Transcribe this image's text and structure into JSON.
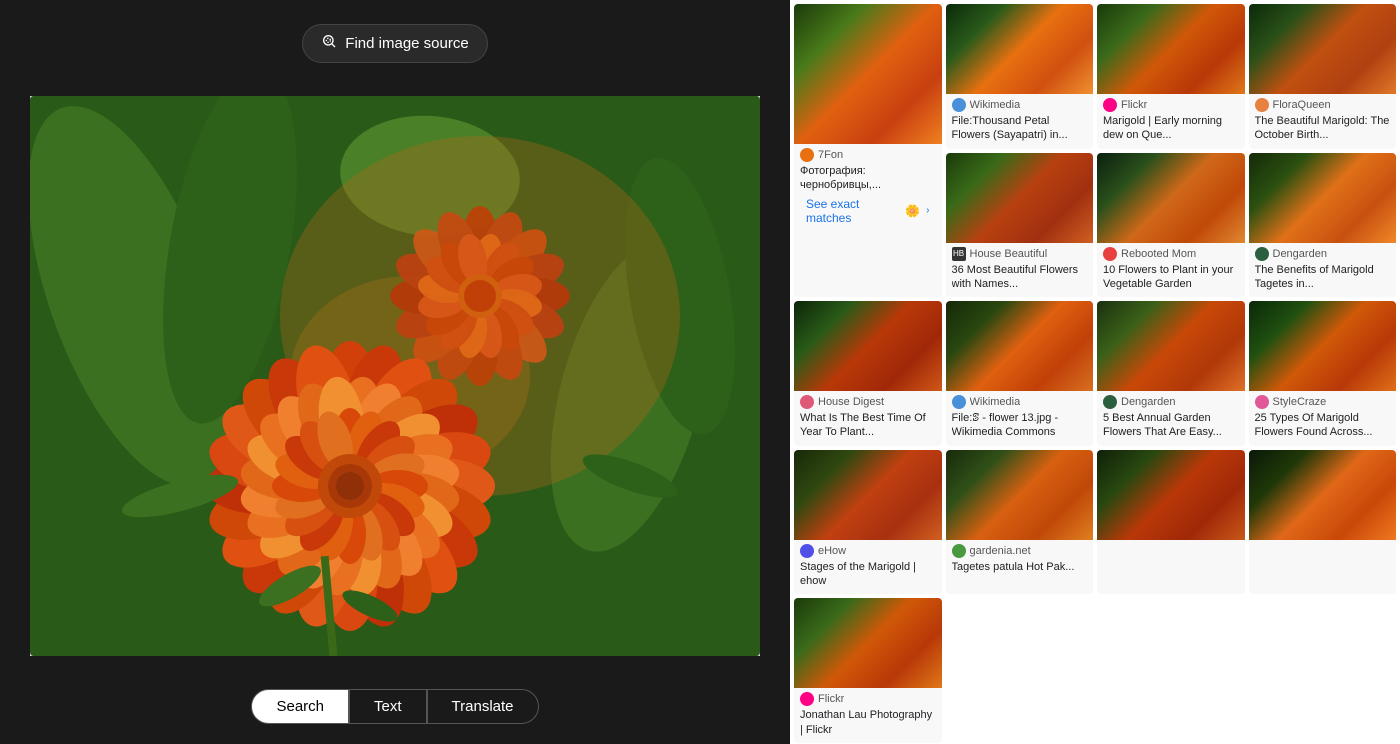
{
  "header": {
    "find_source_label": "Find image source"
  },
  "tabs": [
    {
      "id": "search",
      "label": "Search",
      "active": true
    },
    {
      "id": "text",
      "label": "Text",
      "active": false
    },
    {
      "id": "translate",
      "label": "Translate",
      "active": false
    }
  ],
  "results": [
    {
      "id": 1,
      "source": "7Fon",
      "title": "Фотография: чернобривцы,...",
      "bg": "flower-bg-1",
      "has_exact": true,
      "exact_label": "See exact matches"
    },
    {
      "id": 2,
      "source": "Wikimedia",
      "title": "File:Thousand Petal Flowers (Sayapatri) in...",
      "bg": "flower-bg-2",
      "has_exact": false
    },
    {
      "id": 3,
      "source": "Flickr",
      "title": "Marigold | Early morning dew on Que...",
      "bg": "flower-bg-3",
      "has_exact": false
    },
    {
      "id": 4,
      "source": "FloraQueen",
      "title": "The Beautiful Marigold: The October Birth...",
      "bg": "flower-bg-4",
      "has_exact": false
    },
    {
      "id": 5,
      "source": "House Beautiful",
      "title": "36 Most Beautiful Flowers with Names...",
      "bg": "flower-bg-5",
      "has_exact": false
    },
    {
      "id": 6,
      "source": "Rebooted Mom",
      "title": "10 Flowers to Plant in your Vegetable Garden",
      "bg": "flower-bg-6",
      "has_exact": false
    },
    {
      "id": 7,
      "source": "Dengarden",
      "title": "The Benefits of Marigold Tagetes in...",
      "bg": "flower-bg-7",
      "has_exact": false
    },
    {
      "id": 8,
      "source": "House Digest",
      "title": "What Is The Best Time Of Year To Plant...",
      "bg": "flower-bg-8",
      "has_exact": false
    },
    {
      "id": 9,
      "source": "Wikimedia",
      "title": "File:ꕷ - flower 13.jpg - Wikimedia Commons",
      "bg": "flower-bg-9",
      "has_exact": false
    },
    {
      "id": 10,
      "source": "Dengarden",
      "title": "5 Best Annual Garden Flowers That Are Easy...",
      "bg": "flower-bg-10",
      "has_exact": false
    },
    {
      "id": 11,
      "source": "StyleCraze",
      "title": "25 Types Of Marigold Flowers Found Across...",
      "bg": "flower-bg-11",
      "has_exact": false
    },
    {
      "id": 12,
      "source": "eHow",
      "title": "Stages of the Marigold | ehow",
      "bg": "flower-bg-12",
      "has_exact": false
    },
    {
      "id": 13,
      "source": "gardenia.net",
      "title": "Tagetes patula Hot Pak...",
      "bg": "flower-bg-13",
      "has_exact": false
    },
    {
      "id": 14,
      "source": "",
      "title": "",
      "bg": "flower-bg-14",
      "has_exact": false
    },
    {
      "id": 15,
      "source": "",
      "title": "",
      "bg": "flower-bg-15",
      "has_exact": false
    },
    {
      "id": 16,
      "source": "Flickr",
      "title": "Jonathan Lau Photography | Flickr",
      "bg": "flower-bg-8",
      "has_exact": false
    }
  ],
  "icons": {
    "lens": "🔍",
    "exact_match": "🌼"
  }
}
